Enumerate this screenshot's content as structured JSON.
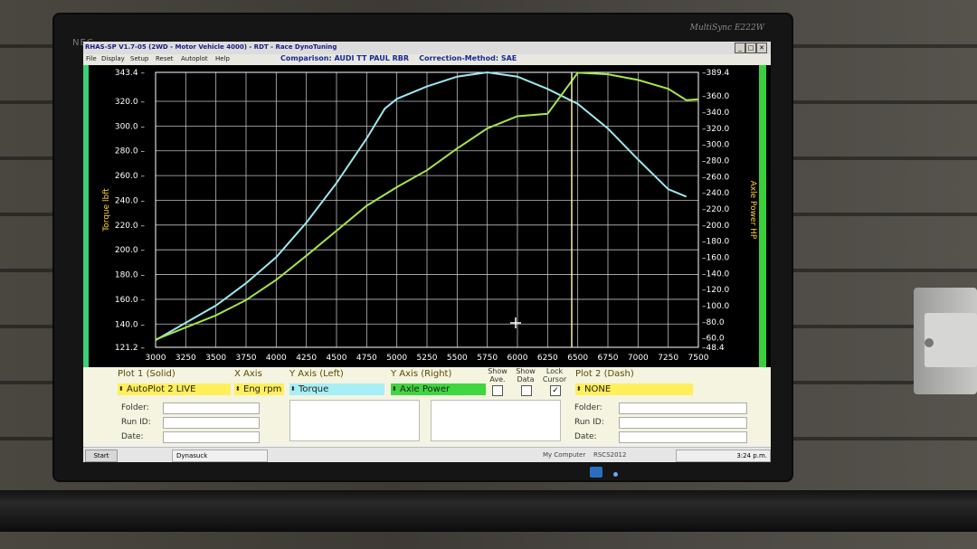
{
  "monitor": {
    "brand": "NEC",
    "model": "MultiSync E222W"
  },
  "window": {
    "title": "RHAS-SP V1.7-05  (2WD - Motor Vehicle 4000) - RDT - Race DynoTuning",
    "buttons": [
      "_",
      "□",
      "✕"
    ]
  },
  "menu": [
    "File",
    "Display",
    "Setup",
    "Reset",
    "Autoplot",
    "Help"
  ],
  "comparison": {
    "text": "Comparison: AUDI TT PAUL RBR",
    "method": "Correction-Method: SAE"
  },
  "chart_data": {
    "type": "line",
    "ylabel_left": "Torque lbft",
    "ylabel_right": "Axle Power HP",
    "x_ticks": [
      "3000",
      "3250",
      "3500",
      "3750",
      "4000",
      "4250",
      "4500",
      "4750",
      "5000",
      "5250",
      "5500",
      "5750",
      "6000",
      "6250",
      "6500",
      "6750",
      "7000",
      "7250",
      "7500"
    ],
    "y_left_ticks": [
      "343.4",
      "320.0",
      "300.0",
      "280.0",
      "260.0",
      "240.0",
      "220.0",
      "200.0",
      "180.0",
      "160.0",
      "140.0",
      "121.2"
    ],
    "y_right_ticks": [
      "389.4",
      "360.0",
      "340.0",
      "320.0",
      "300.0",
      "280.0",
      "260.0",
      "240.0",
      "220.0",
      "200.0",
      "180.0",
      "160.0",
      "140.0",
      "120.0",
      "100.0",
      "80.0",
      "60.0",
      "48.4"
    ],
    "xlim": [
      3000,
      7500
    ],
    "ylim_left": [
      121.2,
      343.4
    ],
    "ylim_right": [
      48.4,
      389.4
    ],
    "cursor_x": 6450,
    "series": [
      {
        "name": "Torque",
        "axis": "left",
        "color": "#9ee7f0",
        "x": [
          3000,
          3250,
          3500,
          3750,
          4000,
          4250,
          4500,
          4750,
          4900,
          5000,
          5250,
          5500,
          5750,
          6000,
          6250,
          6500,
          6750,
          7000,
          7250,
          7400
        ],
        "values": [
          127,
          141,
          155,
          173,
          194,
          222,
          254,
          290,
          314,
          322,
          332,
          340,
          343.4,
          340,
          330,
          318,
          298,
          273,
          249,
          243
        ]
      },
      {
        "name": "Axle Power",
        "axis": "right",
        "color": "#a6e64a",
        "x": [
          3000,
          3250,
          3500,
          3750,
          4000,
          4250,
          4500,
          4750,
          5000,
          5250,
          5500,
          5750,
          6000,
          6250,
          6500,
          6750,
          7000,
          7250,
          7400,
          7500
        ],
        "values": [
          58,
          73,
          88,
          107,
          132,
          162,
          193,
          224,
          247,
          268,
          295,
          320,
          335,
          338,
          389,
          387,
          380,
          369,
          355,
          356
        ]
      }
    ]
  },
  "controls": {
    "plot1_label": "Plot 1 (Solid)",
    "xaxis_label": "X Axis",
    "yleft_label": "Y Axis (Left)",
    "yright_label": "Y Axis (Right)",
    "show_ave": "Show Ave.",
    "show_data": "Show Data",
    "lock_cursor": "Lock Cursor",
    "plot2_label": "Plot 2 (Dash)",
    "plot1_value": "AutoPlot 2 LIVE",
    "xaxis_value": "Eng rpm",
    "yleft_value": "Torque",
    "yright_value": "Axle Power",
    "plot2_value": "NONE",
    "folder": "Folder:",
    "run_id": "Run ID:",
    "date": "Date:",
    "colors": {
      "plot1": "#ffef5a",
      "xaxis": "#ffef5a",
      "yleft": "#a8eef6",
      "yright": "#3fd63f",
      "plot2": "#ffef5a"
    }
  },
  "taskbar": {
    "start": "Start",
    "task": "Dynasuck",
    "computer": "My Computer",
    "tray_icons": "RSCS2012",
    "clock": "3:24 p.m."
  }
}
